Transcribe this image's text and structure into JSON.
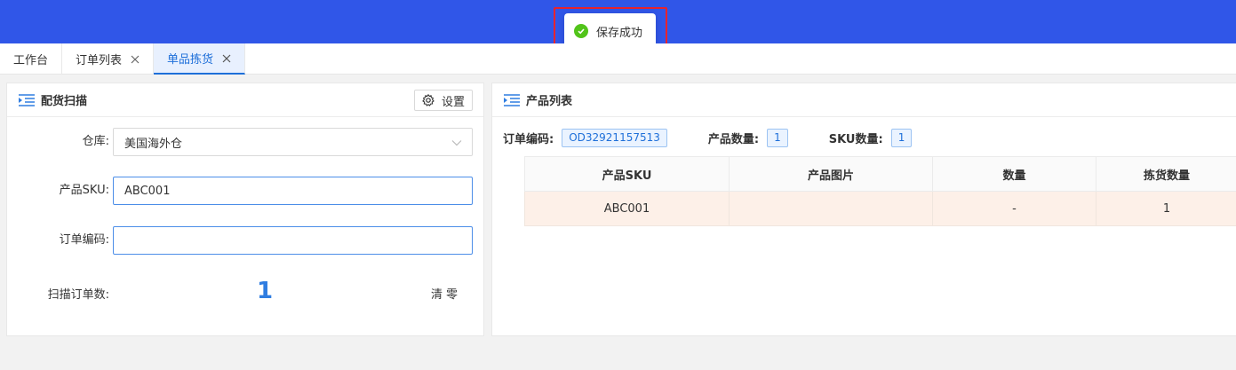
{
  "toast": {
    "message": "保存成功",
    "icon": "check-circle-icon",
    "color": "#52c41a"
  },
  "tabs": [
    {
      "label": "工作台",
      "closable": false,
      "active": false
    },
    {
      "label": "订单列表",
      "closable": true,
      "active": false
    },
    {
      "label": "单品拣货",
      "closable": true,
      "active": true
    }
  ],
  "left_panel": {
    "title": "配货扫描",
    "settings_label": "设置",
    "warehouse": {
      "label": "仓库:",
      "value": "美国海外仓"
    },
    "sku": {
      "label": "产品SKU:",
      "value": "ABC001"
    },
    "order_code": {
      "label": "订单编码:",
      "value": ""
    },
    "scan_count": {
      "label": "扫描订单数:",
      "value": "1"
    },
    "clear_label": "清零"
  },
  "right_panel": {
    "title": "产品列表",
    "order_code_label": "订单编码:",
    "order_code_value": "OD32921157513",
    "product_qty_label": "产品数量:",
    "product_qty_value": "1",
    "sku_qty_label": "SKU数量:",
    "sku_qty_value": "1",
    "table": {
      "headers": [
        "产品SKU",
        "产品图片",
        "数量",
        "拣货数量"
      ],
      "rows": [
        [
          "ABC001",
          "",
          "-",
          "1"
        ]
      ]
    }
  },
  "colors": {
    "header_bar": "#3056e8",
    "accent": "#1e6fd9",
    "row_highlight": "#fdf0e8",
    "toast_outline": "#e8232d"
  }
}
